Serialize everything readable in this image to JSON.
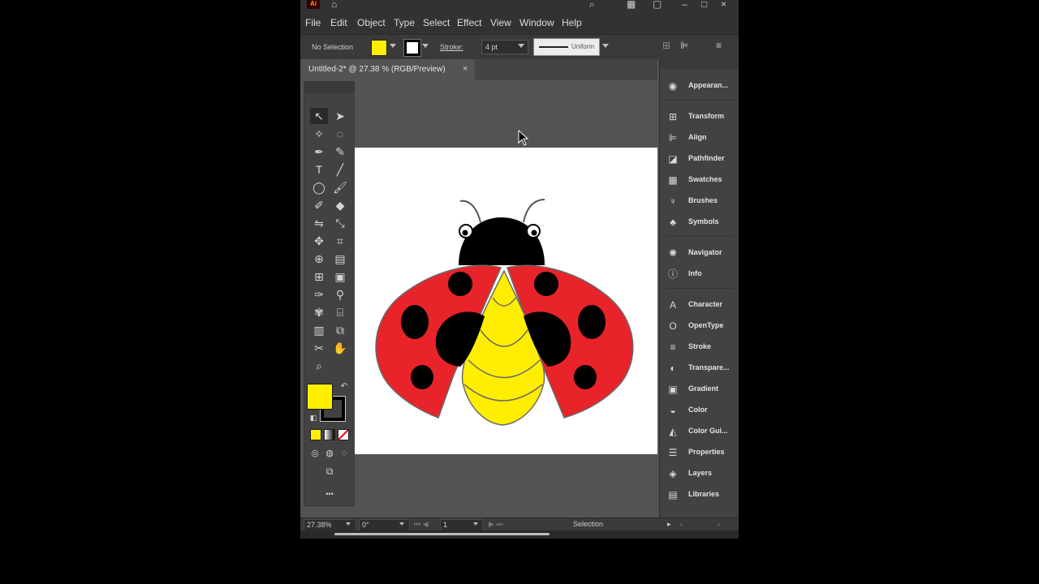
{
  "menu": {
    "items": [
      "File",
      "Edit",
      "Object",
      "Type",
      "Select",
      "Effect",
      "View",
      "Window",
      "Help"
    ]
  },
  "control_bar": {
    "selection_label": "No Selection",
    "stroke_label": "Stroke:",
    "stroke_weight": "4 pt",
    "profile_label": "Uniform",
    "fill_color": "#ffee00",
    "stroke_color": "#000000"
  },
  "document": {
    "tab_title": "Untitled-2* @ 27.38 % (RGB/Preview)",
    "close_glyph": "×"
  },
  "panels": [
    {
      "label": "Appearan...",
      "icon": "appearance-icon"
    },
    {
      "label": "Transform",
      "icon": "transform-icon"
    },
    {
      "label": "Align",
      "icon": "align-icon"
    },
    {
      "label": "Pathfinder",
      "icon": "pathfinder-icon"
    },
    {
      "label": "Swatches",
      "icon": "swatches-icon"
    },
    {
      "label": "Brushes",
      "icon": "brushes-icon"
    },
    {
      "label": "Symbols",
      "icon": "symbols-icon"
    },
    {
      "label": "Navigator",
      "icon": "navigator-icon"
    },
    {
      "label": "Info",
      "icon": "info-icon"
    },
    {
      "label": "Character",
      "icon": "character-icon"
    },
    {
      "label": "OpenType",
      "icon": "opentype-icon"
    },
    {
      "label": "Stroke",
      "icon": "stroke-icon"
    },
    {
      "label": "Transpare...",
      "icon": "transparency-icon"
    },
    {
      "label": "Gradient",
      "icon": "gradient-icon"
    },
    {
      "label": "Color",
      "icon": "color-icon"
    },
    {
      "label": "Color Gui...",
      "icon": "color-guide-icon"
    },
    {
      "label": "Properties",
      "icon": "properties-icon"
    },
    {
      "label": "Layers",
      "icon": "layers-icon"
    },
    {
      "label": "Libraries",
      "icon": "libraries-icon"
    }
  ],
  "status_bar": {
    "zoom": "27.38%",
    "rotation": "0°",
    "artboard": "1",
    "tool": "Selection"
  },
  "toolbar": {
    "more_glyph": "•••"
  },
  "colors": {
    "ladybug_red": "#e8232a",
    "ladybug_yellow": "#ffee00",
    "ladybug_black": "#000000"
  }
}
